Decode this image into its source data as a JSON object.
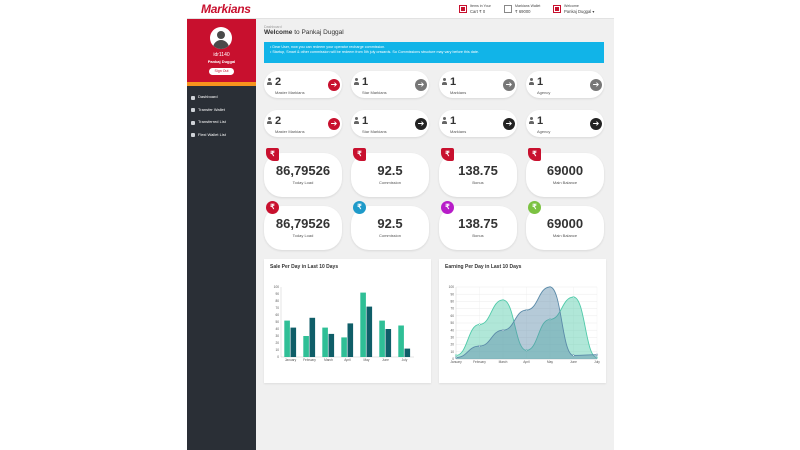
{
  "header": {
    "logo": "Markians",
    "items": [
      {
        "line1": "Items in Your",
        "line2": "Cart ₹ 0"
      },
      {
        "line1": "Markians Wallet",
        "line2": "₹ 69000"
      },
      {
        "line1": "Welcome",
        "line2": "Pankaj Duggal ▾"
      }
    ]
  },
  "sidebar": {
    "user_id": "idr1140",
    "user_name": "Pankaj Duggal",
    "signout": "Sign Out",
    "items": [
      {
        "label": "Dashboard"
      },
      {
        "label": "Transfer Wallet"
      },
      {
        "label": "Transferred List"
      },
      {
        "label": "Flexi Wallet List"
      }
    ]
  },
  "main": {
    "breadcrumb": "Dashboard",
    "welcome_prefix": "Welcome",
    "welcome_rest": " to Pankaj Duggal",
    "notice": [
      "• Dear User, now you can redeem your operator recharge commission.",
      "• Startup, Smart & other commission will be redeem from 5th july onwards. So Commissions structure may vary before this date."
    ],
    "count_rows": [
      [
        {
          "value": "2",
          "label": "Master Markians",
          "arrow_color": "#c8102e"
        },
        {
          "value": "1",
          "label": "Star Markians",
          "arrow_color": "#777777"
        },
        {
          "value": "1",
          "label": "Markians",
          "arrow_color": "#777777"
        },
        {
          "value": "1",
          "label": "Agency",
          "arrow_color": "#777777"
        }
      ],
      [
        {
          "value": "2",
          "label": "Master Markians",
          "arrow_color": "#c8102e"
        },
        {
          "value": "1",
          "label": "Star Markians",
          "arrow_color": "#222222"
        },
        {
          "value": "1",
          "label": "Markians",
          "arrow_color": "#222222"
        },
        {
          "value": "1",
          "label": "Agency",
          "arrow_color": "#222222"
        }
      ]
    ],
    "balance_rows": [
      [
        {
          "value": "86,79526",
          "label": "Today Load",
          "color": "#c8102e",
          "shape": "sq"
        },
        {
          "value": "92.5",
          "label": "Commission",
          "color": "#c8102e",
          "shape": "sq"
        },
        {
          "value": "138.75",
          "label": "Bonus",
          "color": "#c8102e",
          "shape": "sq"
        },
        {
          "value": "69000",
          "label": "Main Balance",
          "color": "#c8102e",
          "shape": "sq"
        }
      ],
      [
        {
          "value": "86,79526",
          "label": "Today Load",
          "color": "#c8102e",
          "shape": "circ"
        },
        {
          "value": "92.5",
          "label": "Commission",
          "color": "#1e9ac9",
          "shape": "circ"
        },
        {
          "value": "138.75",
          "label": "Bonus",
          "color": "#b71cc8",
          "shape": "circ"
        },
        {
          "value": "69000",
          "label": "Main Balance",
          "color": "#7cc242",
          "shape": "circ"
        }
      ]
    ],
    "rupee_symbol": "₹",
    "arrow_symbol": "➔"
  },
  "chart_data": [
    {
      "type": "bar",
      "title": "Sale Per Day in Last 10 Days",
      "categories": [
        "January",
        "February",
        "March",
        "April",
        "May",
        "June",
        "July"
      ],
      "ylim": [
        0,
        100
      ],
      "yticks": [
        0,
        10,
        20,
        30,
        40,
        50,
        60,
        70,
        80,
        90,
        100
      ],
      "series": [
        {
          "values": [
            52,
            30,
            42,
            28,
            92,
            52,
            45
          ],
          "color": "#2fbf96"
        },
        {
          "values": [
            42,
            56,
            33,
            48,
            72,
            40,
            12
          ],
          "color": "#0f5e68"
        }
      ]
    },
    {
      "type": "area",
      "title": "Earning Per Day in Last 10 Days",
      "categories": [
        "January",
        "February",
        "March",
        "April",
        "May",
        "June",
        "July"
      ],
      "ylim": [
        0,
        100
      ],
      "yticks": [
        0,
        10,
        20,
        30,
        40,
        50,
        60,
        70,
        80,
        90,
        100
      ],
      "series": [
        {
          "values": [
            5,
            48,
            82,
            12,
            55,
            86,
            2
          ],
          "color": "#4fcaa9"
        },
        {
          "values": [
            2,
            18,
            40,
            68,
            100,
            5,
            6
          ],
          "color": "#5a8aa8"
        }
      ]
    }
  ]
}
